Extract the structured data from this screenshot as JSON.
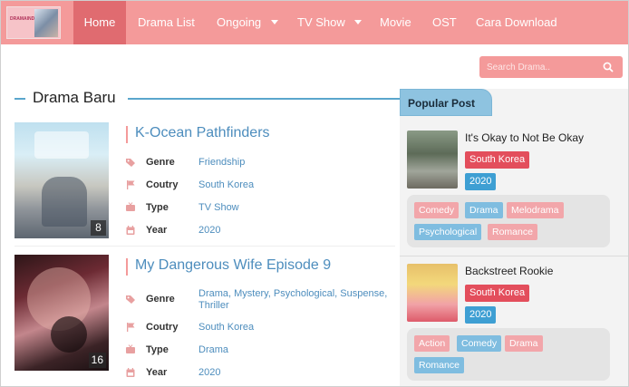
{
  "nav": {
    "logo_text": "DRAMAINDO",
    "items": [
      {
        "label": "Home",
        "active": true
      },
      {
        "label": "Drama List"
      },
      {
        "label": "Ongoing"
      },
      {
        "label": "TV Show"
      },
      {
        "label": "Movie"
      },
      {
        "label": "OST"
      },
      {
        "label": "Cara Download"
      }
    ]
  },
  "search": {
    "placeholder": "Search Drama.."
  },
  "section": {
    "title": "Drama Baru"
  },
  "labels": {
    "genre": "Genre",
    "country": "Coutry",
    "type": "Type",
    "year": "Year"
  },
  "dramas": [
    {
      "title": "K-Ocean Pathfinders",
      "episode": "8",
      "genre": "Friendship",
      "country": "South Korea",
      "type": "TV Show",
      "year": "2020"
    },
    {
      "title": "My Dangerous Wife Episode 9",
      "episode": "16",
      "genre": "Drama, Mystery, Psychological, Suspense, Thriller",
      "country": "South Korea",
      "type": "Drama",
      "year": "2020"
    }
  ],
  "sidebar": {
    "title": "Popular Post",
    "posts": [
      {
        "title": "It's Okay to Not Be Okay",
        "country": "South Korea",
        "year": "2020",
        "tags": [
          "Comedy",
          "Drama",
          "Melodrama",
          "Psychological",
          "Romance"
        ]
      },
      {
        "title": "Backstreet Rookie",
        "country": "South Korea",
        "year": "2020",
        "tags": [
          "Action",
          "Comedy",
          "Drama",
          "Romance"
        ]
      }
    ]
  },
  "colors": {
    "accent": "#f49a9a",
    "active_nav": "#e06b70",
    "link_blue": "#4d8dbd",
    "country_badge": "#e34e5c",
    "year_badge": "#3e9fd3"
  },
  "icons": {
    "genre": "tag-icon",
    "country": "flag-icon",
    "type": "tv-icon",
    "year": "calendar-icon",
    "search": "search-icon"
  }
}
